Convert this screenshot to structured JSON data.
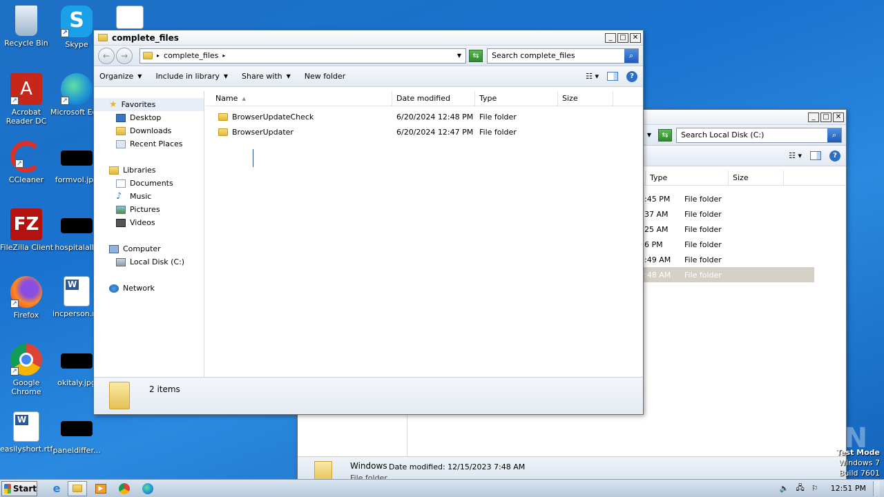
{
  "desktop": {
    "icons": [
      {
        "label": "Recycle Bin"
      },
      {
        "label": "Skype"
      },
      {
        "label": "Acrobat Reader DC"
      },
      {
        "label": "Microsoft Edge"
      },
      {
        "label": "CCleaner"
      },
      {
        "label": "formvol.jpg"
      },
      {
        "label": "FileZilla Client"
      },
      {
        "label": "hospitalallo"
      },
      {
        "label": "Firefox"
      },
      {
        "label": "incperson.rtf"
      },
      {
        "label": "Google Chrome"
      },
      {
        "label": "okitaly.jpg"
      },
      {
        "label": "easilyshort.rtf"
      },
      {
        "label": "paneldiffer..."
      }
    ],
    "watermark": "ANY RUN",
    "test_mode": {
      "line1": "Test Mode",
      "line2": "Windows 7",
      "line3": "Build 7601"
    }
  },
  "back_window": {
    "search_placeholder": "Search Local Disk (C:)",
    "columns": {
      "type": "Type",
      "size": "Size"
    },
    "rows": [
      {
        "date_tail": ":45 PM",
        "type": "File folder"
      },
      {
        "date_tail": "37 AM",
        "type": "File folder"
      },
      {
        "date_tail": "25 AM",
        "type": "File folder"
      },
      {
        "date_tail": "6 PM",
        "type": "File folder"
      },
      {
        "date_tail": ":49 AM",
        "type": "File folder"
      },
      {
        "date_tail": ":48 AM",
        "type": "File folder"
      }
    ],
    "details": {
      "name": "Windows",
      "date": "Date modified: 12/15/2023 7:48 AM",
      "type": "File folder"
    }
  },
  "front_window": {
    "title": "complete_files",
    "address": "complete_files",
    "search_placeholder": "Search complete_files",
    "toolbar": {
      "organize": "Organize",
      "include": "Include in library",
      "share": "Share with",
      "new_folder": "New folder"
    },
    "nav": {
      "favorites": "Favorites",
      "desktop": "Desktop",
      "downloads": "Downloads",
      "recent": "Recent Places",
      "libraries": "Libraries",
      "documents": "Documents",
      "music": "Music",
      "pictures": "Pictures",
      "videos": "Videos",
      "computer": "Computer",
      "local_disk": "Local Disk (C:)",
      "network": "Network"
    },
    "columns": {
      "name": "Name",
      "date": "Date modified",
      "type": "Type",
      "size": "Size"
    },
    "files": [
      {
        "name": "BrowserUpdateCheck",
        "date": "6/20/2024 12:48 PM",
        "type": "File folder"
      },
      {
        "name": "BrowserUpdater",
        "date": "6/20/2024 12:47 PM",
        "type": "File folder"
      }
    ],
    "status": "2 items"
  },
  "taskbar": {
    "start": "Start",
    "clock": "12:51 PM"
  }
}
